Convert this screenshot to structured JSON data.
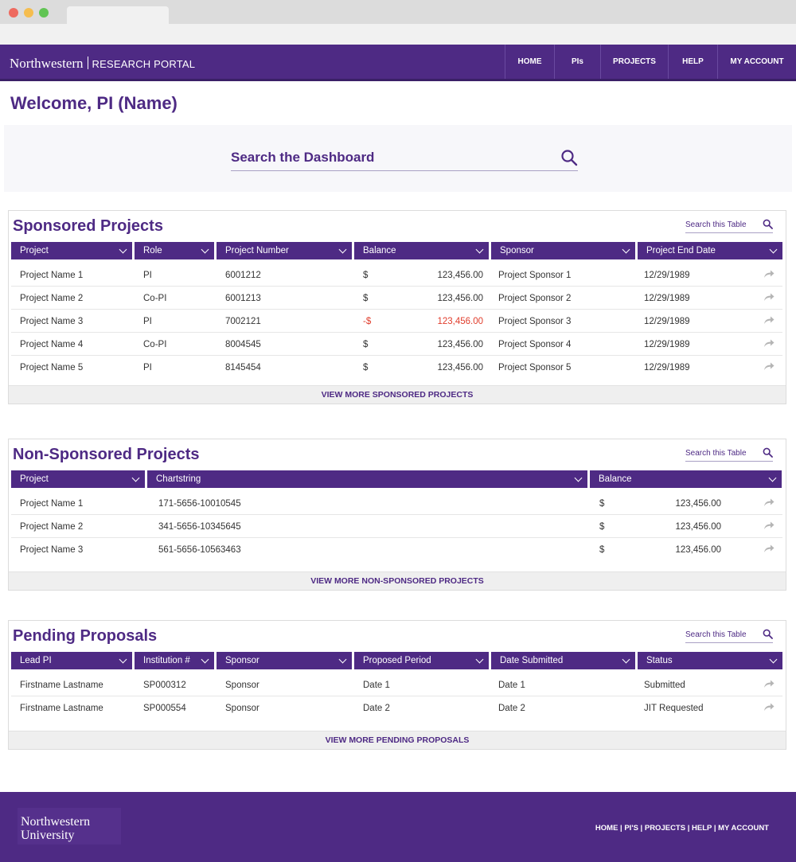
{
  "header": {
    "brand_name": "Northwestern",
    "brand_portal": "RESEARCH PORTAL",
    "nav": [
      {
        "label": "HOME"
      },
      {
        "label": "PIs"
      },
      {
        "label": "PROJECTS"
      },
      {
        "label": "HELP"
      },
      {
        "label": "MY ACCOUNT"
      }
    ]
  },
  "welcome": "Welcome, PI (Name)",
  "search": {
    "placeholder": "Search the Dashboard"
  },
  "sponsored": {
    "title": "Sponsored Projects",
    "search_label": "Search this Table",
    "columns": [
      "Project",
      "Role",
      "Project Number",
      "Balance",
      "Sponsor",
      "Project End Date"
    ],
    "rows": [
      {
        "project": "Project Name 1",
        "role": "PI",
        "number": "6001212",
        "currency": "$",
        "balance": "123,456.00",
        "negative": false,
        "sponsor": "Project Sponsor 1",
        "end_date": "12/29/1989"
      },
      {
        "project": "Project Name 2",
        "role": "Co-PI",
        "number": "6001213",
        "currency": "$",
        "balance": "123,456.00",
        "negative": false,
        "sponsor": "Project Sponsor 2",
        "end_date": "12/29/1989"
      },
      {
        "project": "Project Name 3",
        "role": "PI",
        "number": "7002121",
        "currency": "-$",
        "balance": "123,456.00",
        "negative": true,
        "sponsor": "Project Sponsor 3",
        "end_date": "12/29/1989"
      },
      {
        "project": "Project Name 4",
        "role": "Co-PI",
        "number": "8004545",
        "currency": "$",
        "balance": "123,456.00",
        "negative": false,
        "sponsor": "Project Sponsor 4",
        "end_date": "12/29/1989"
      },
      {
        "project": "Project Name 5",
        "role": "PI",
        "number": "8145454",
        "currency": "$",
        "balance": "123,456.00",
        "negative": false,
        "sponsor": "Project Sponsor 5",
        "end_date": "12/29/1989"
      }
    ],
    "view_more": "VIEW MORE SPONSORED PROJECTS"
  },
  "nonsponsored": {
    "title": "Non-Sponsored Projects",
    "search_label": "Search this Table",
    "columns": [
      "Project",
      "Chartstring",
      "Balance"
    ],
    "rows": [
      {
        "project": "Project Name 1",
        "chartstring": "171-5656-10010545",
        "currency": "$",
        "balance": "123,456.00"
      },
      {
        "project": "Project Name 2",
        "chartstring": "341-5656-10345645",
        "currency": "$",
        "balance": "123,456.00"
      },
      {
        "project": "Project Name 3",
        "chartstring": "561-5656-10563463",
        "currency": "$",
        "balance": "123,456.00"
      }
    ],
    "view_more": "VIEW MORE NON-SPONSORED PROJECTS"
  },
  "proposals": {
    "title": "Pending Proposals",
    "search_label": "Search this Table",
    "columns": [
      "Lead PI",
      "Institution #",
      "Sponsor",
      "Proposed Period",
      "Date Submitted",
      "Status"
    ],
    "rows": [
      {
        "lead": "Firstname Lastname",
        "institution": "SP000312",
        "sponsor": "Sponsor",
        "period": "Date 1",
        "submitted": "Date 1",
        "status": "Submitted"
      },
      {
        "lead": "Firstname Lastname",
        "institution": "SP000554",
        "sponsor": "Sponsor",
        "period": "Date 2",
        "submitted": "Date 2",
        "status": "JIT Requested"
      }
    ],
    "view_more": "VIEW MORE PENDING PROPOSALS"
  },
  "footer": {
    "logo_line1": "Northwestern",
    "logo_line2": "University",
    "links": [
      {
        "label": "HOME"
      },
      {
        "label": "PI'S"
      },
      {
        "label": "PROJECTS"
      },
      {
        "label": "HELP"
      },
      {
        "label": "MY ACCOUNT"
      }
    ]
  },
  "colors": {
    "brand_purple": "#4e2a84",
    "negative_red": "#e03c2b"
  }
}
